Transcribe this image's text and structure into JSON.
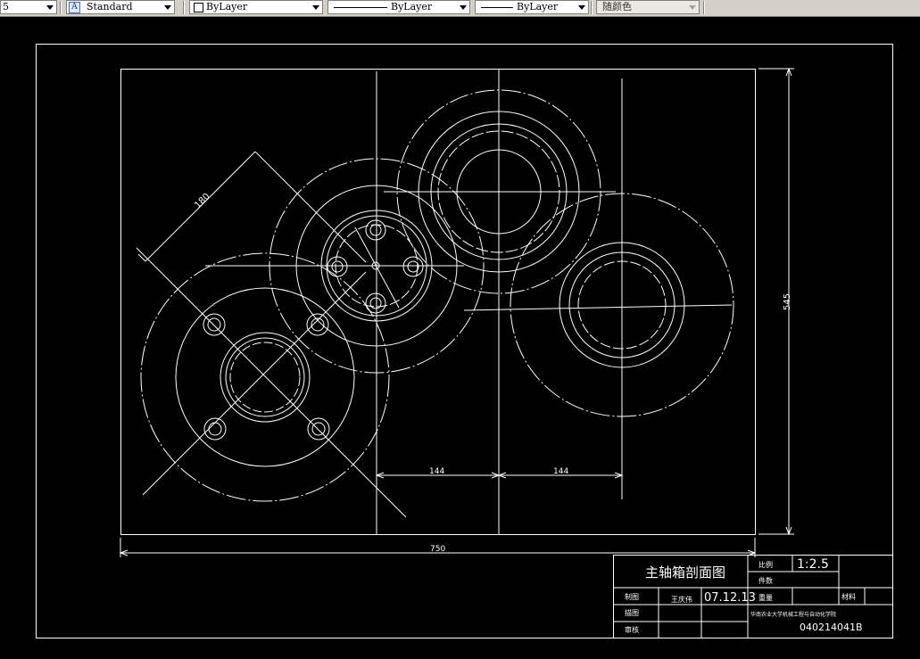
{
  "toolbar": {
    "layer_combo_value": "5",
    "text_style_value": "Standard",
    "layer_prop_value": "ByLayer",
    "linetype_value": "ByLayer",
    "lineweight_value": "ByLayer",
    "plotstyle_value": "随颜色"
  },
  "drawing": {
    "dimensions": {
      "radius": "180",
      "total_height": "545",
      "spacing_left": "144",
      "spacing_right": "144",
      "total_width": "750"
    },
    "title_block": {
      "title": "主轴箱剖面图",
      "scale_label": "比例",
      "scale_value": "1:2.5",
      "quantity_label": "件数",
      "drawn_label": "制图",
      "drawn_name": "王庆伟",
      "drawn_date": "07.12.13",
      "weight_label": "重量",
      "material_label": "材料",
      "design_label": "描图",
      "check_label": "审核",
      "school": "华南农业大学机械工程与自动化学院",
      "drawing_number": "040214041B"
    }
  }
}
